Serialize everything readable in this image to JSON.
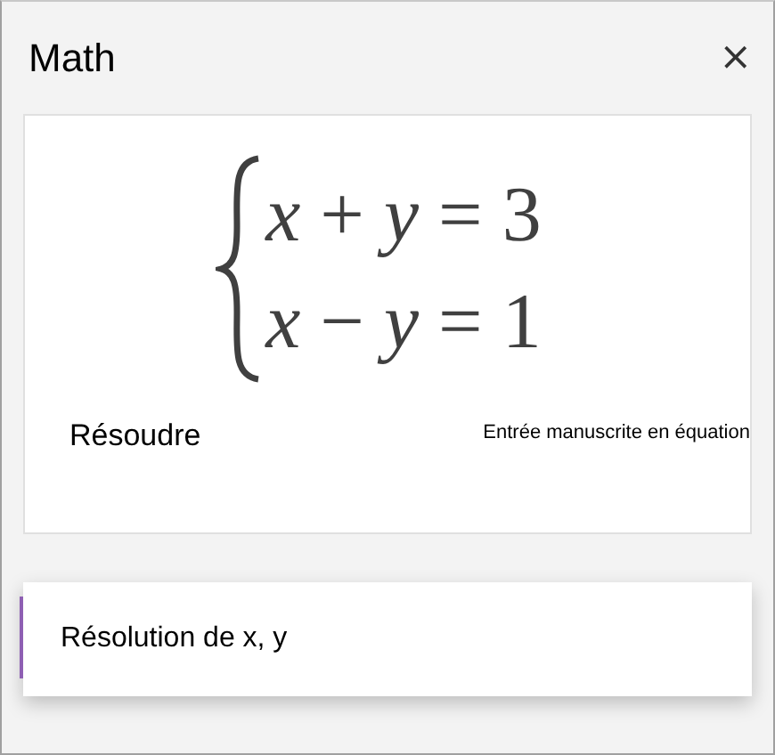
{
  "panel": {
    "title": "Math",
    "close": "×"
  },
  "equation_card": {
    "equations": [
      "*x* + *y* = 3",
      "*x* − *y* = 1"
    ],
    "solve_label": "Résoudre",
    "ink_link": "Entrée manuscrite en équation"
  },
  "options": [
    {
      "label": "Résolution de x, y",
      "selected": true
    }
  ]
}
